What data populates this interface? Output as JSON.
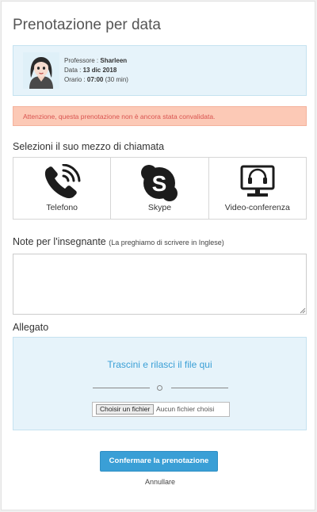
{
  "page": {
    "title": "Prenotazione per data"
  },
  "booking": {
    "teacher_label": "Professore :",
    "teacher_value": "Sharleen",
    "date_label": "Data :",
    "date_value": "13 dic 2018",
    "time_label": "Orario :",
    "time_value": "07:00",
    "duration": "(30 min)"
  },
  "alert": {
    "text": "Attenzione, questa prenotazione non è ancora stata convalidata."
  },
  "call_methods": {
    "heading": "Selezioni il suo mezzo di chiamata",
    "options": [
      {
        "label": "Telefono",
        "icon": "phone-icon"
      },
      {
        "label": "Skype",
        "icon": "skype-icon"
      },
      {
        "label": "Video-conferenza",
        "icon": "headset-monitor-icon"
      }
    ]
  },
  "notes": {
    "heading": "Note per l'insegnante",
    "hint": "(La preghiamo di scrivere in Inglese)",
    "value": ""
  },
  "attachment": {
    "heading": "Allegato",
    "drop_text": "Trascini e rilasci il file qui",
    "separator": "o",
    "choose_button": "Choisir un fichier",
    "file_status": "Aucun fichier choisi"
  },
  "actions": {
    "confirm": "Confermare la prenotazione",
    "cancel": "Annullare"
  },
  "colors": {
    "accent": "#3a9fd6",
    "info_bg": "#e6f3fa",
    "alert_bg": "#fcc9b6",
    "alert_text": "#d9534f"
  }
}
